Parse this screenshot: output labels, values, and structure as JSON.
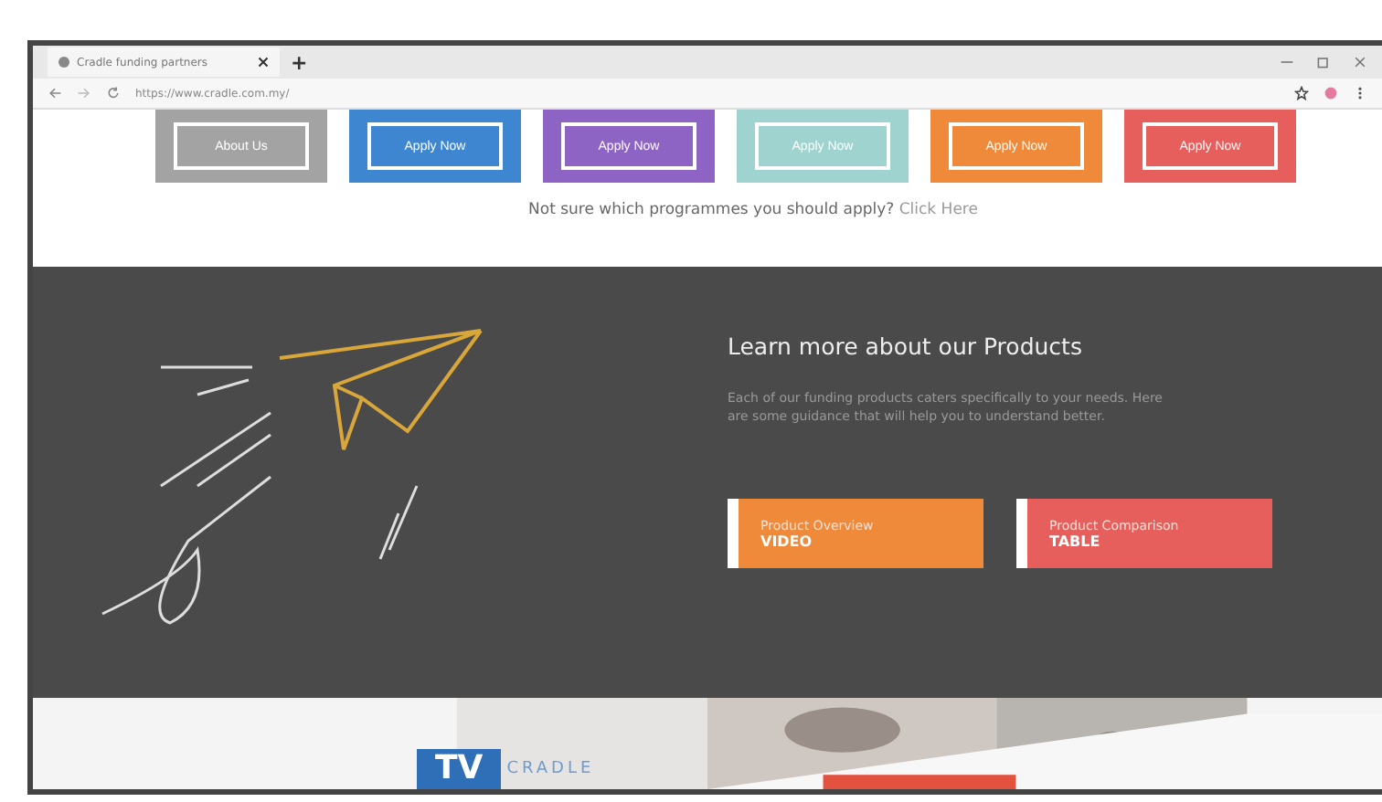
{
  "browser": {
    "tab_title": "Cradle funding partners",
    "new_tab": "+",
    "url": "https://www.cradle.com.my/"
  },
  "apply_buttons": [
    {
      "label": "About Us",
      "color": "#a3a3a3"
    },
    {
      "label": "Apply Now",
      "color": "#3f86d0"
    },
    {
      "label": "Apply Now",
      "color": "#8d63c4"
    },
    {
      "label": "Apply Now",
      "color": "#9fd3cf"
    },
    {
      "label": "Apply Now",
      "color": "#ee8a3a"
    },
    {
      "label": "Apply Now",
      "color": "#e65f5c"
    }
  ],
  "hint": {
    "text": "Not sure which programmes you should apply?",
    "link": "Click Here"
  },
  "products": {
    "title": "Learn more about our Products",
    "body": "Each of our funding products caters specifically to your needs. Here are some guidance that will help you to understand better.",
    "buttons": [
      {
        "caption": "Product Overview",
        "label": "VIDEO",
        "color": "#ee8a3a"
      },
      {
        "caption": "Product Comparison",
        "label": "TABLE",
        "color": "#e65f5c"
      }
    ]
  },
  "footer_banner": {
    "logo": "TV",
    "brand": "CRADLE"
  }
}
